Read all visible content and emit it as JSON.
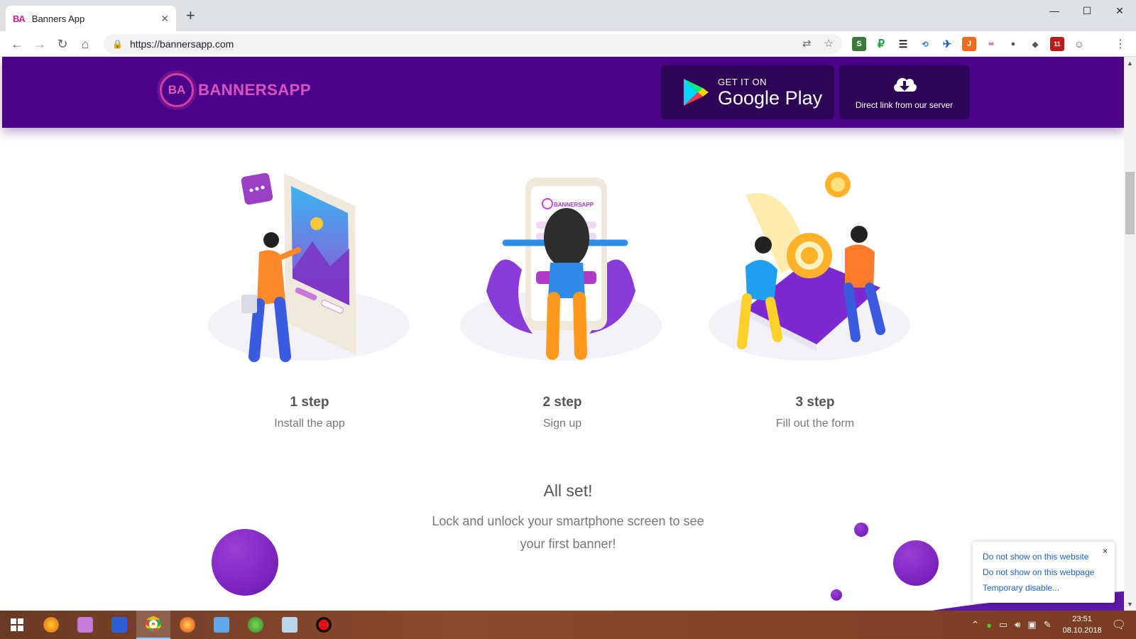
{
  "browser": {
    "tab_title": "Banners App",
    "tab_favicon": "BA",
    "url": "https://bannersapp.com",
    "extension_badge": "11"
  },
  "header": {
    "logo_mark": "BA",
    "logo_text": "BANNERSAPP",
    "google_play_small": "GET IT ON",
    "google_play_big": "Google Play",
    "direct_link_label": "Direct link from our server"
  },
  "steps": [
    {
      "title": "1 step",
      "desc": "Install the app"
    },
    {
      "title": "2 step",
      "desc": "Sign up"
    },
    {
      "title": "3 step",
      "desc": "Fill out the form"
    }
  ],
  "illustration_phone_logo": "BANNERSAPP",
  "allset": {
    "title": "All set!",
    "desc": "Lock and unlock your smartphone screen to see your first banner!"
  },
  "popup": {
    "link1": "Do not show on this website",
    "link2": "Do not show on this webpage",
    "link3": "Temporary disable...",
    "close": "×"
  },
  "taskbar": {
    "time": "23:51",
    "date": "08.10.2018"
  },
  "colors": {
    "header_bg": "#4a0389",
    "button_bg": "#2c0654",
    "accent_pink": "#d23fa6",
    "deco_purple": "#7a22c0"
  }
}
